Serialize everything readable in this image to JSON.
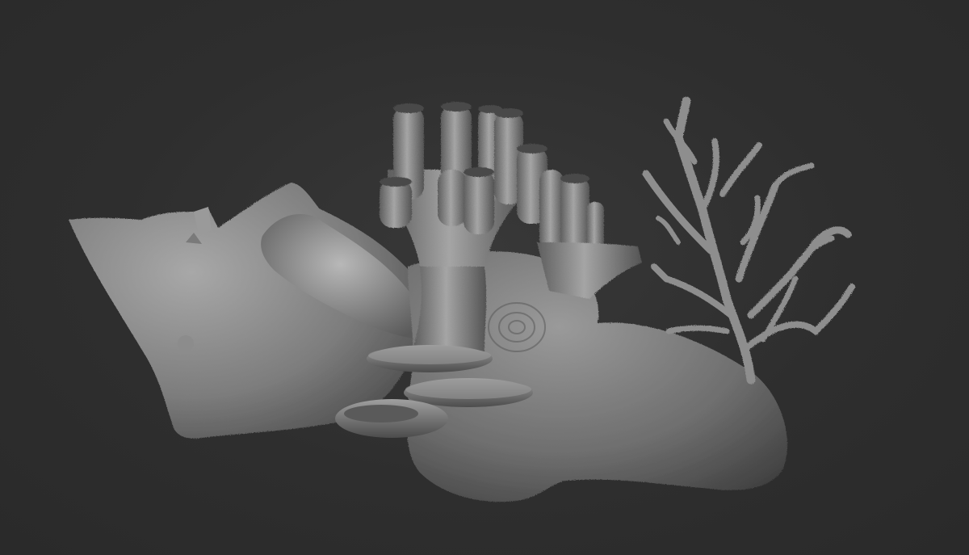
{
  "scene": {
    "background_color": "#2e2e2e",
    "material_color": "#8a8a8a",
    "objects": [
      {
        "name": "conch-shell",
        "icon": "shell-icon"
      },
      {
        "name": "tube-sponge",
        "icon": "sponge-icon"
      },
      {
        "name": "shelf-fungus",
        "icon": "fungus-icon"
      },
      {
        "name": "rock-base",
        "icon": "rock-icon"
      },
      {
        "name": "branching-coral",
        "icon": "coral-icon"
      }
    ]
  }
}
